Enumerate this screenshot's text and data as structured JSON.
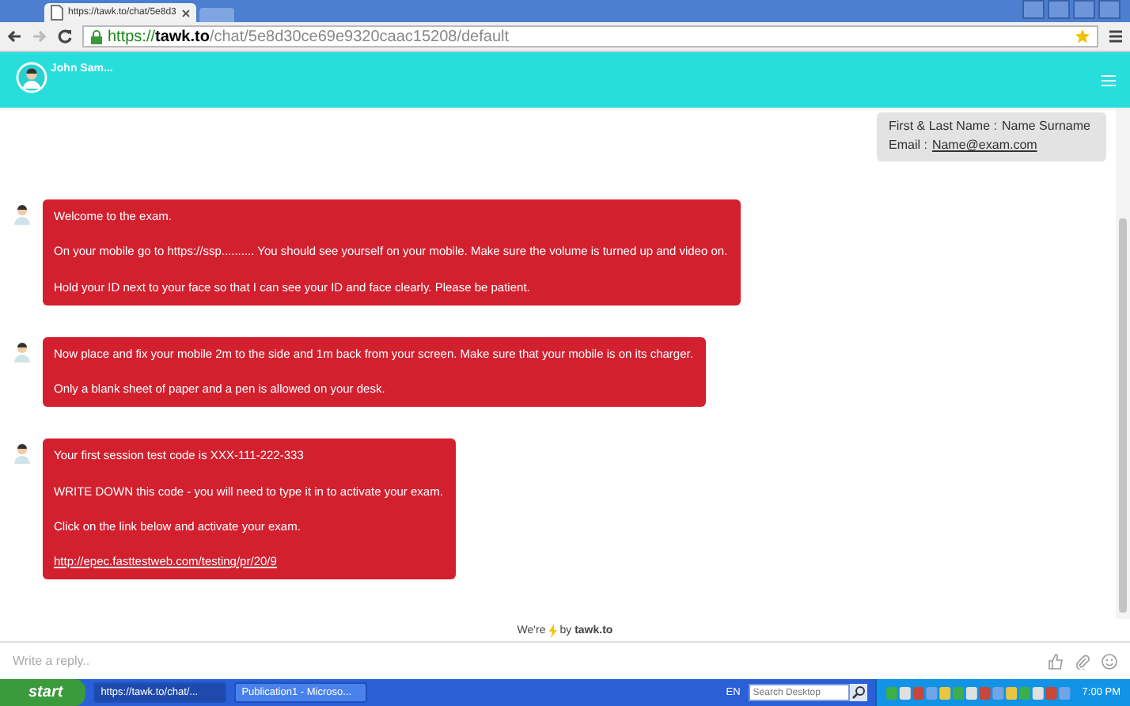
{
  "browser": {
    "tab_title": "https://tawk.to/chat/5e8d3",
    "url_scheme": "https://",
    "url_host": "tawk.to",
    "url_path": "/chat/5e8d30ce69e9320caac15208/default"
  },
  "header": {
    "agent_name": "John Sam..."
  },
  "messages": [
    {
      "kind": "visitor",
      "fields": [
        {
          "label": "First & Last Name :",
          "value": "Name Surname",
          "link": false
        },
        {
          "label": "Email :",
          "value": "Name@exam.com",
          "link": true
        }
      ]
    },
    {
      "kind": "agent",
      "paragraphs": [
        {
          "kind": "text",
          "text": "Welcome to the exam."
        },
        {
          "kind": "text",
          "text": "On your mobile go to https://ssp.......... You should see yourself on your mobile. Make sure the volume is turned up and video on."
        },
        {
          "kind": "text",
          "text": "Hold your ID next to your face so that I can see your ID and face clearly. Please be patient."
        }
      ]
    },
    {
      "kind": "agent",
      "paragraphs": [
        {
          "kind": "text",
          "text": "Now place and fix your mobile 2m to the side and 1m back from your screen. Make sure that your mobile is on its charger."
        },
        {
          "kind": "text",
          "text": "Only a blank sheet of paper and a pen is allowed on your desk."
        }
      ]
    },
    {
      "kind": "agent",
      "paragraphs": [
        {
          "kind": "text",
          "text": "Your first session test code is XXX-111-222-333"
        },
        {
          "kind": "text",
          "text": "WRITE DOWN this code - you will need to type it in to activate your exam."
        },
        {
          "kind": "text",
          "text": "Click on the link below and activate your exam."
        },
        {
          "kind": "link",
          "text": "http://epec.fasttestweb.com/testing/pr/20/9"
        }
      ]
    }
  ],
  "footer": {
    "prefix": "We're",
    "suffix": "by **tawk.to**"
  },
  "composer": {
    "placeholder": "Write a reply.."
  },
  "taskbar": {
    "start": "start",
    "tasks": [
      {
        "label": "https://tawk.to/chat/...",
        "selected": true
      },
      {
        "label": "Publication1 - Microso...",
        "selected": false
      }
    ],
    "language": "EN",
    "search_placeholder": "Search Desktop",
    "clock": "7:00 PM"
  }
}
